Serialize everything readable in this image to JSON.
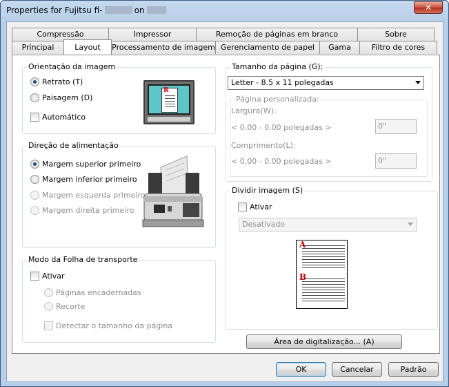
{
  "window": {
    "title_prefix": "Properties for Fujitsu fi-",
    "title_on": "on",
    "close_glyph": "✕"
  },
  "tabs": {
    "row_top": [
      {
        "label": "Compressão"
      },
      {
        "label": "Impressor"
      },
      {
        "label": "Remoção de páginas em branco"
      },
      {
        "label": "Sobre"
      }
    ],
    "row_bottom": [
      {
        "label": "Principal"
      },
      {
        "label": "Layout",
        "active": true
      },
      {
        "label": "Processamento de imagem"
      },
      {
        "label": "Gerenciamento de papel"
      },
      {
        "label": "Gama"
      },
      {
        "label": "Filtro de cores"
      }
    ]
  },
  "orientation": {
    "title": "Orientação da imagem",
    "portrait": "Retrato (T)",
    "landscape": "Paisagem (D)",
    "automatic": "Automático",
    "selected": "portrait",
    "preview_letter": "R"
  },
  "feed": {
    "title": "Direção de alimentação",
    "top_first": "Margem superior primeiro",
    "bottom_first": "Margem inferior primeiro",
    "left_first": "Margem esquerda primeiro",
    "right_first": "Margem direita primeiro",
    "selected": "top_first"
  },
  "carrier": {
    "title": "Modo da Folha de transporte",
    "enable": "Ativar",
    "bound_pages": "Páginas encadernadas",
    "cut": "Recorte",
    "detect_size": "Detectar o tamanho da página"
  },
  "page_size": {
    "title": "Tamanho da página (G):",
    "selected": "Letter - 8.5 x 11 polegadas",
    "custom_title": "Página personalizada:",
    "width_label": "Largura(W):",
    "width_range": "< 0.00 - 0.00 polegadas >",
    "width_value": "0\"",
    "length_label": "Comprimento(L):",
    "length_range": "< 0.00 - 0.00 polegadas >",
    "length_value": "0\""
  },
  "split": {
    "title": "Dividir imagem (S)",
    "enable": "Ativar",
    "mode": "Desativado",
    "label_a": "A",
    "label_b": "B"
  },
  "buttons": {
    "scan_area": "Área de digitalização... (A)",
    "ok": "OK",
    "cancel": "Cancelar",
    "default": "Padrão"
  }
}
